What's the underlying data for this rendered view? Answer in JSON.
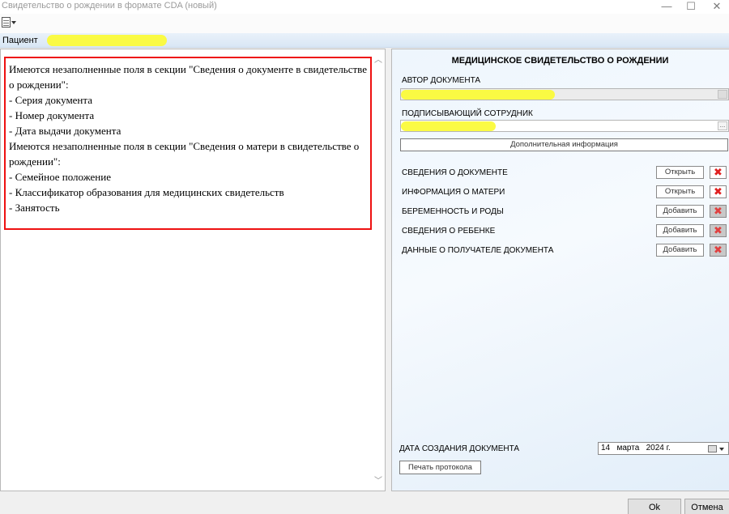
{
  "window": {
    "title": "Свидетельство о рождении в формате CDA (новый)",
    "minimize": "—",
    "maximize": "☐",
    "close": "✕"
  },
  "patient_bar": {
    "label": "Пациент"
  },
  "validation": {
    "lines": [
      "Имеются незаполненные поля в секции \"Сведения о документе в свидетельстве о рождении\":",
      "- Серия документа",
      "- Номер документа",
      "- Дата выдачи документа",
      "Имеются незаполненные поля в секции \"Сведения о матери в свидетельстве о рождении\":",
      "- Семейное положение",
      "- Классификатор образования для медицинских свидетельств",
      "- Занятость"
    ]
  },
  "form": {
    "title": "МЕДИЦИНСКОЕ СВИДЕТЕЛЬСТВО О РОЖДЕНИИ",
    "author_label": "АВТОР ДОКУМЕНТА",
    "signer_label": "ПОДПИСЫВАЮЩИЙ СОТРУДНИК",
    "ellipsis": "...",
    "extra_info_button": "Дополнительная информация",
    "sections": [
      {
        "label": "СВЕДЕНИЯ О ДОКУМЕНТЕ",
        "button": "Открыть",
        "delete_enabled": true
      },
      {
        "label": "ИНФОРМАЦИЯ О МАТЕРИ",
        "button": "Открыть",
        "delete_enabled": true
      },
      {
        "label": "БЕРЕМЕННОСТЬ И РОДЫ",
        "button": "Добавить",
        "delete_enabled": false
      },
      {
        "label": "СВЕДЕНИЯ О РЕБЕНКЕ",
        "button": "Добавить",
        "delete_enabled": false
      },
      {
        "label": "ДАННЫЕ О ПОЛУЧАТЕЛЕ ДОКУМЕНТА",
        "button": "Добавить",
        "delete_enabled": false
      }
    ],
    "delete_icon": "red-x-icon",
    "creation_date_label": "ДАТА СОЗДАНИЯ ДОКУМЕНТА",
    "creation_date_value": "14   марта   2024 г.",
    "print_button": "Печать протокола"
  },
  "footer": {
    "ok": "Ok",
    "cancel": "Отмена"
  },
  "colors": {
    "error_border": "#e11111",
    "highlight": "#fbfb3a",
    "delete_icon": "#e02020"
  }
}
